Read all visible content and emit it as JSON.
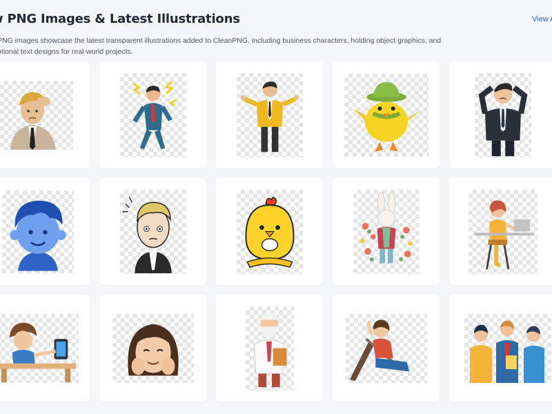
{
  "header": {
    "title": "w PNG Images & Latest Illustrations",
    "view_all": "View A",
    "description": "PNG images showcase the latest transparent illustrations added to CleanPNG, including business characters, holding object graphics, and otional text designs for real-world projects."
  },
  "colors": {
    "accent": "#2563eb",
    "page_bg": "#f5f6f8",
    "card_bg": "#ffffff"
  },
  "grid": {
    "cards": [
      {
        "subject": "stressed-businessman"
      },
      {
        "subject": "dazed-businessman-walking"
      },
      {
        "subject": "shrugging-man-yellow-jacket"
      },
      {
        "subject": "dancing-chick-with-hat"
      },
      {
        "subject": "worried-businessman"
      },
      {
        "subject": "blue-haired-character"
      },
      {
        "subject": "anxious-man-in-suit"
      },
      {
        "subject": "chick-holding-object"
      },
      {
        "subject": "bunny-with-flowers"
      },
      {
        "subject": "woman-at-laptop-desk"
      },
      {
        "subject": "boy-with-tablet-at-desk"
      },
      {
        "subject": "smiling-girl-hands-on-cheeks"
      },
      {
        "subject": "old-doctor-with-clipboard"
      },
      {
        "subject": "relaxing-woman-in-chair"
      },
      {
        "subject": "business-team-meeting"
      }
    ]
  }
}
